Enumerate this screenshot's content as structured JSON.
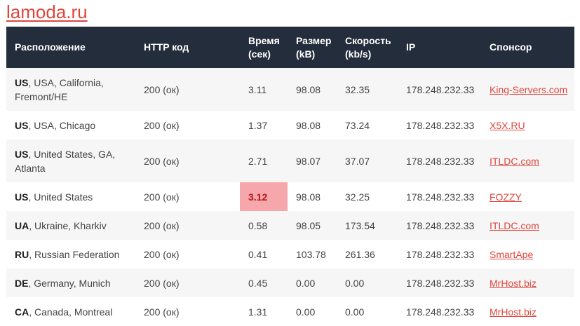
{
  "site": {
    "title": "lamoda.ru"
  },
  "table": {
    "headers": {
      "location": "Расположение",
      "http_code": "HTTP код",
      "time_1": "Время",
      "time_2": "(сек)",
      "size_1": "Размер",
      "size_2": "(kB)",
      "speed_1": "Скорость",
      "speed_2": "(kb/s)",
      "ip": "IP",
      "sponsor": "Спонсор"
    },
    "highlight_color": "#f6a7ab",
    "link_color": "#e0453c",
    "header_bg": "#242d3b",
    "rows": [
      {
        "cc": "US",
        "location": ", USA, California, Fremont/HE",
        "http": "200 (ок)",
        "time": "3.11",
        "size": "98.08",
        "speed": "32.35",
        "ip": "178.248.232.33",
        "sponsor": "King-Servers.com"
      },
      {
        "cc": "US",
        "location": ", USA, Chicago",
        "http": "200 (ок)",
        "time": "1.37",
        "size": "98.08",
        "speed": "73.24",
        "ip": "178.248.232.33",
        "sponsor": "X5X.RU"
      },
      {
        "cc": "US",
        "location": ", United States, GA, Atlanta",
        "http": "200 (ок)",
        "time": "2.71",
        "size": "98.07",
        "speed": "37.07",
        "ip": "178.248.232.33",
        "sponsor": "ITLDC.com"
      },
      {
        "cc": "US",
        "location": ", United States",
        "http": "200 (ок)",
        "time": "3.12",
        "size": "98.08",
        "speed": "32.25",
        "ip": "178.248.232.33",
        "sponsor": "FOZZY"
      },
      {
        "cc": "UA",
        "location": ", Ukraine, Kharkiv",
        "http": "200 (ок)",
        "time": "0.58",
        "size": "98.05",
        "speed": "173.54",
        "ip": "178.248.232.33",
        "sponsor": "ITLDC.com"
      },
      {
        "cc": "RU",
        "location": ", Russian Federation",
        "http": "200 (ок)",
        "time": "0.41",
        "size": "103.78",
        "speed": "261.36",
        "ip": "178.248.232.33",
        "sponsor": "SmartApe"
      },
      {
        "cc": "DE",
        "location": ", Germany, Munich",
        "http": "200 (ок)",
        "time": "0.45",
        "size": "0.00",
        "speed": "0.00",
        "ip": "178.248.232.33",
        "sponsor": "MrHost.biz"
      },
      {
        "cc": "CA",
        "location": ", Canada, Montreal",
        "http": "200 (ок)",
        "time": "1.31",
        "size": "0.00",
        "speed": "0.00",
        "ip": "178.248.232.33",
        "sponsor": "MrHost.biz"
      }
    ]
  }
}
